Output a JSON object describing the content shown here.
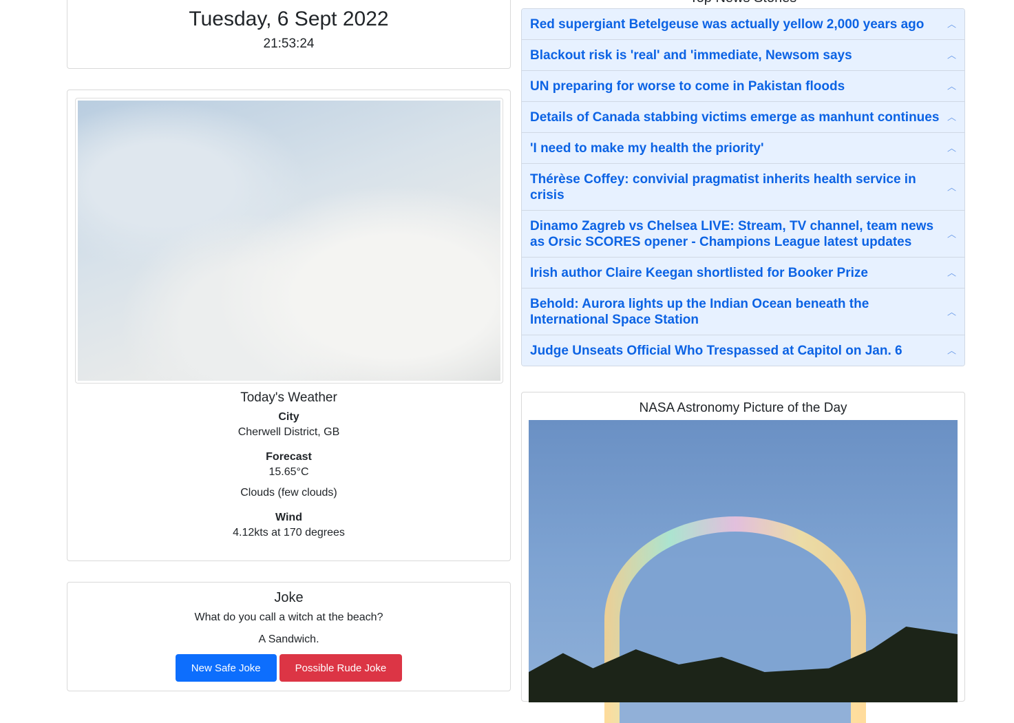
{
  "datetime": {
    "date": "Tuesday, 6 Sept 2022",
    "time": "21:53:24"
  },
  "weather": {
    "title": "Today's Weather",
    "city_label": "City",
    "city": "Cherwell District, GB",
    "forecast_label": "Forecast",
    "temp": "15.65°C",
    "conditions": "Clouds (few clouds)",
    "wind_label": "Wind",
    "wind": "4.12kts at 170 degrees"
  },
  "joke": {
    "title": "Joke",
    "setup": "What do you call a witch at the beach?",
    "punchline": "A Sandwich.",
    "safe_button": "New Safe Joke",
    "rude_button": "Possible Rude Joke"
  },
  "news": {
    "title": "Top News Stories",
    "items": [
      "Red supergiant Betelgeuse was actually yellow 2,000 years ago",
      "Blackout risk is 'real' and 'immediate, Newsom says",
      "UN preparing for worse to come in Pakistan floods",
      "Details of Canada stabbing victims emerge as manhunt continues",
      "'I need to make my health the priority'",
      "Thérèse Coffey: convivial pragmatist inherits health service in crisis",
      "Dinamo Zagreb vs Chelsea LIVE: Stream, TV channel, team news as Orsic SCORES opener - Champions League latest updates",
      "Irish author Claire Keegan shortlisted for Booker Prize",
      "Behold: Aurora lights up the Indian Ocean beneath the International Space Station",
      "Judge Unseats Official Who Trespassed at Capitol on Jan. 6"
    ]
  },
  "apod": {
    "title": "NASA Astronomy Picture of the Day"
  },
  "colors": {
    "primary": "#0d6efd",
    "danger": "#dc3545",
    "accordion_bg": "#e7f1ff",
    "link": "#0c63e4"
  }
}
